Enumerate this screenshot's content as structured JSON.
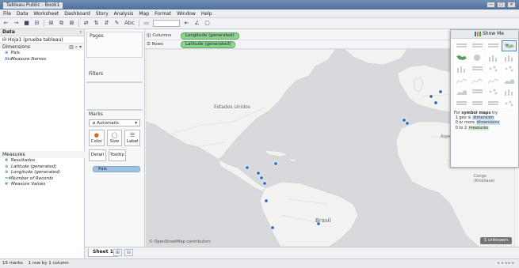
{
  "window": {
    "title": "Tableau Public - Book1",
    "buttons": [
      "—",
      "□",
      "✕"
    ]
  },
  "menu": [
    "File",
    "Data",
    "Worksheet",
    "Dashboard",
    "Story",
    "Analysis",
    "Map",
    "Format",
    "Window",
    "Help"
  ],
  "toolbar": {
    "abc_label": "Abc"
  },
  "data_pane": {
    "title": "Data",
    "source": "Hoja1 (prueba tableau)",
    "dimensions_label": "Dimensions",
    "dimensions": [
      {
        "icon": "⊕",
        "name": "Pais"
      },
      {
        "icon": "Abc",
        "name": "Measure Names"
      }
    ],
    "measures_label": "Measures",
    "measures": [
      {
        "icon": "#",
        "name": "Resultados"
      },
      {
        "icon": "⊕",
        "name": "Latitude (generated)"
      },
      {
        "icon": "⊕",
        "name": "Longitude (generated)"
      },
      {
        "icon": "=#",
        "name": "Number of Records"
      },
      {
        "icon": "#",
        "name": "Measure Values"
      }
    ]
  },
  "cards": {
    "pages": "Pages",
    "filters": "Filters",
    "marks": "Marks",
    "mark_type": "Automatic",
    "color": "Color",
    "size": "Size",
    "label": "Label",
    "detail": "Detail",
    "tooltip": "Tooltip",
    "detail_pill": "Pais"
  },
  "shelves": {
    "columns_label": "Columns",
    "columns_pill": "Longitude (generated)",
    "rows_label": "Rows",
    "rows_pill": "Latitude (generated)"
  },
  "map": {
    "labels": {
      "usa": "Estados Unidos",
      "brazil": "Brasil",
      "algeria": "Algeria",
      "congo": "Congo (Kinshasa)"
    },
    "attribution": "© OpenStreetMap contributors",
    "unknown_badge": "1 unknown"
  },
  "show_me": {
    "title": "Show Me",
    "selected_chart": "symbol maps",
    "hint_prefix": "For",
    "hint_chart": "symbol maps",
    "hint_suffix": "try",
    "req1_prefix": "1 geo",
    "req1_hl": "dimension",
    "req2_prefix": "0 or more",
    "req2_hl": "dimensions",
    "req3_prefix": "0 to 2",
    "req3_hl": "measures"
  },
  "sheet_tab": "Sheet 1",
  "status": "15 marks    1 row by 1 column",
  "colors": {
    "accent": "#4a86c8",
    "measure_pill": "#8fd18f",
    "dimension_pill": "#9fc1e4",
    "mark": "#2e6bbf"
  }
}
